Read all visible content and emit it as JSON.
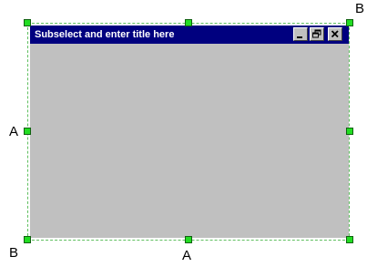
{
  "window": {
    "title": "Subselect and enter title here",
    "buttons": {
      "minimize_icon": "minimize-icon",
      "restore_icon": "restore-icon",
      "close_icon": "close-icon"
    }
  },
  "labels": {
    "top_right": "B",
    "left_middle": "A",
    "bottom_left": "B",
    "bottom_middle": "A"
  },
  "colors": {
    "title_bar": "#00007f",
    "window_body": "#c0c0c0",
    "handle_fill": "#22dd22",
    "selection_border": "#5fbf5f"
  }
}
